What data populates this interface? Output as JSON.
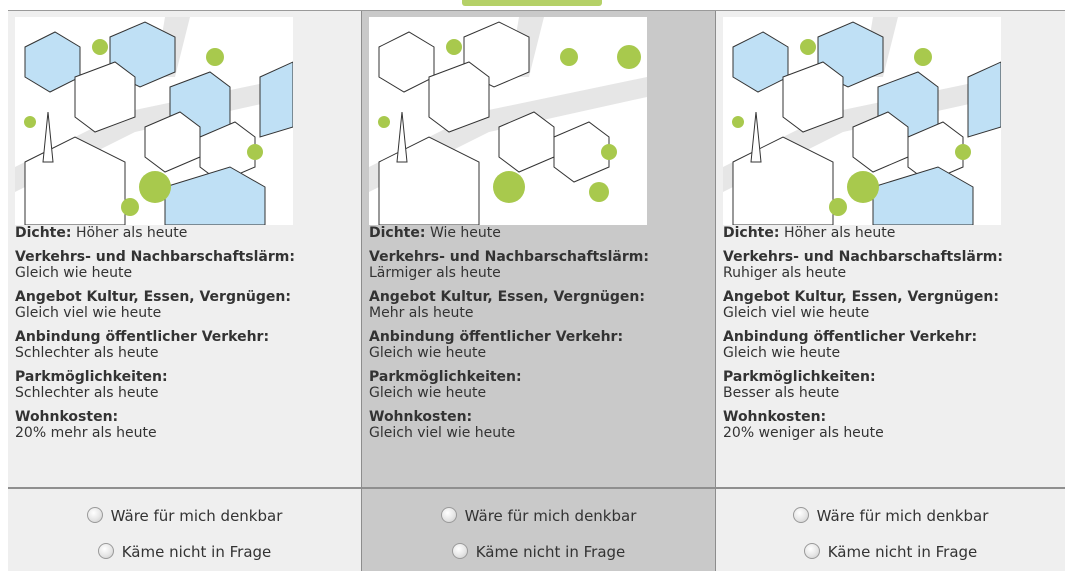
{
  "columns": [
    {
      "attributes": [
        {
          "label": "Dichte:",
          "value": "Höher als heute"
        },
        {
          "label": "Verkehrs- und Nachbarschaftslärm:",
          "value": "Gleich wie heute"
        },
        {
          "label": "Angebot Kultur, Essen, Vergnügen:",
          "value": "Gleich viel wie heute"
        },
        {
          "label": "Anbindung öffentlicher Verkehr:",
          "value": "Schlechter als heute"
        },
        {
          "label": "Parkmöglichkeiten:",
          "value": "Schlechter als heute"
        },
        {
          "label": "Wohnkosten:",
          "value": "20% mehr als heute"
        }
      ],
      "options": [
        "Wäre für mich denkbar",
        "Käme nicht in Frage"
      ]
    },
    {
      "attributes": [
        {
          "label": "Dichte:",
          "value": "Wie heute"
        },
        {
          "label": "Verkehrs- und Nachbarschaftslärm:",
          "value": "Lärmiger als heute"
        },
        {
          "label": "Angebot Kultur, Essen, Vergnügen:",
          "value": "Mehr als heute"
        },
        {
          "label": "Anbindung öffentlicher Verkehr:",
          "value": "Gleich wie heute"
        },
        {
          "label": "Parkmöglichkeiten:",
          "value": "Gleich wie heute"
        },
        {
          "label": "Wohnkosten:",
          "value": "Gleich viel wie heute"
        }
      ],
      "options": [
        "Wäre für mich denkbar",
        "Käme nicht in Frage"
      ]
    },
    {
      "attributes": [
        {
          "label": "Dichte:",
          "value": "Höher als heute"
        },
        {
          "label": "Verkehrs- und Nachbarschaftslärm:",
          "value": "Ruhiger als heute"
        },
        {
          "label": "Angebot Kultur, Essen, Vergnügen:",
          "value": "Gleich viel wie heute"
        },
        {
          "label": "Anbindung öffentlicher Verkehr:",
          "value": "Gleich wie heute"
        },
        {
          "label": "Parkmöglichkeiten:",
          "value": "Besser als heute"
        },
        {
          "label": "Wohnkosten:",
          "value": "20% weniger als heute"
        }
      ],
      "options": [
        "Wäre für mich denkbar",
        "Käme nicht in Frage"
      ]
    }
  ],
  "colors": {
    "highlight_column": "#c9c9c9",
    "column_bg": "#efefef",
    "building_blue": "#bfe0f5",
    "tree_green": "#a8c94d"
  },
  "illustration_icons": [
    "city-block-illustration-dense",
    "city-block-illustration-current",
    "city-block-illustration-dense"
  ]
}
